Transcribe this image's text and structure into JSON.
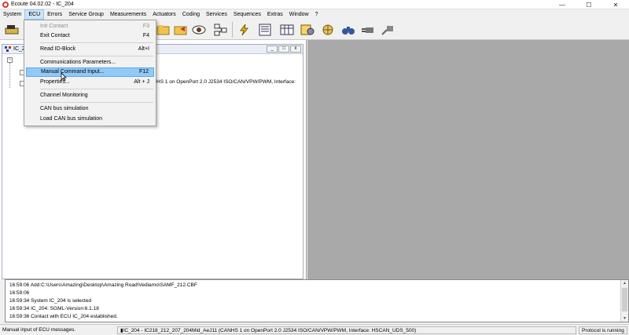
{
  "window": {
    "title": "Ecoute 04.02.02 - IC_204",
    "buttons": [
      "—",
      "☐",
      "✕"
    ]
  },
  "menubar": [
    "System",
    "ECU",
    "Errors",
    "Service Group",
    "Measurements",
    "Actuators",
    "Coding",
    "Services",
    "Sequences",
    "Extras",
    "Window",
    "?"
  ],
  "ecu_menu": {
    "items": [
      {
        "label": "Init Contact",
        "shortcut": "F3",
        "enabled": false
      },
      {
        "label": "Exit Contact",
        "shortcut": "F4",
        "enabled": true
      },
      {
        "label": "Read ID-Block",
        "shortcut": "Alt+I",
        "enabled": true
      },
      {
        "label": "Communications Parameters...",
        "shortcut": "",
        "enabled": true
      },
      {
        "label": "Manual Command Input...",
        "shortcut": "F12",
        "enabled": true,
        "highlighted": true
      },
      {
        "label": "Properties...",
        "shortcut": "Alt + J",
        "enabled": true
      },
      {
        "label": "Channel Monitoring",
        "shortcut": "",
        "enabled": true
      },
      {
        "label": "CAN bus simulation",
        "shortcut": "",
        "enabled": true
      },
      {
        "label": "Load CAN bus simulation",
        "shortcut": "",
        "enabled": true
      }
    ]
  },
  "toolbar": {
    "icons": [
      "ecu-icon",
      "open-folder-icon",
      "eye-icon",
      "network-icon",
      "flash-icon",
      "list-icon",
      "table-icon",
      "coding-icon",
      "globe-icon",
      "binoculars-icon",
      "plug-icon",
      "unplug-icon"
    ]
  },
  "child_window": {
    "title": "IC_2",
    "buttons": [
      "_",
      "□",
      "x"
    ],
    "connection_text": "HS 1 on OpenPort 2.0 J2534 ISO/CAN/VPW/PWM, Interface:"
  },
  "log": {
    "lines": [
      "16:59:06 Add:C:\\Users\\Amazing\\Desktop\\Amazing Road\\Vediamo\\SAMF_212.CBF",
      "16:59:06",
      "16:59:34 System IC_204 is selected",
      "16:59:34 IC_204: SGML-Version:6.1.18",
      "16:59:36 Contact with ECU IC_204 established."
    ]
  },
  "statusbar": {
    "message": "Manual input of ECU messages.",
    "connection": "IC_204 - IC218_212_207_204Mid_AeJ11 (CANHS 1 on OpenPort 2.0 J2534 ISO/CAN/VPW/PWM, Interface: HSCAN_UDS_500)",
    "state": "Protocol is running"
  }
}
